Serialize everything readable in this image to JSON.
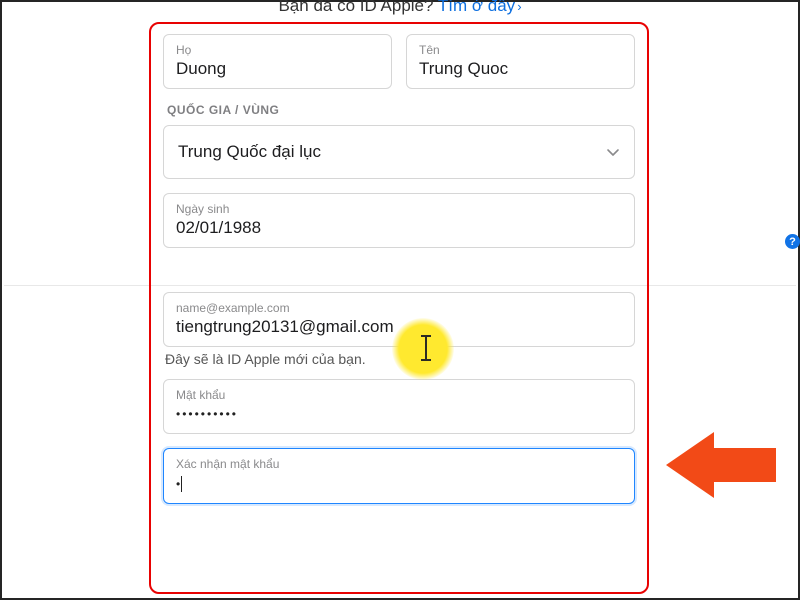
{
  "header": {
    "question": "Bạn đã có ID Apple?",
    "link": "Tìm ở đây"
  },
  "form": {
    "lastName": {
      "label": "Họ",
      "value": "Duong"
    },
    "firstName": {
      "label": "Tên",
      "value": "Trung Quoc"
    },
    "regionSection": "QUỐC GIA / VÙNG",
    "region": {
      "value": "Trung Quốc đại lục"
    },
    "dob": {
      "label": "Ngày sinh",
      "value": "02/01/1988"
    },
    "email": {
      "placeholder": "name@example.com",
      "value": "tiengtrung20131@gmail.com"
    },
    "emailHelper": "Đây sẽ là ID Apple mới của bạn.",
    "password": {
      "label": "Mật khẩu",
      "masked": "••••••••••"
    },
    "confirm": {
      "label": "Xác nhận mật khẩu",
      "masked": "•"
    }
  },
  "icons": {
    "help": "?"
  }
}
